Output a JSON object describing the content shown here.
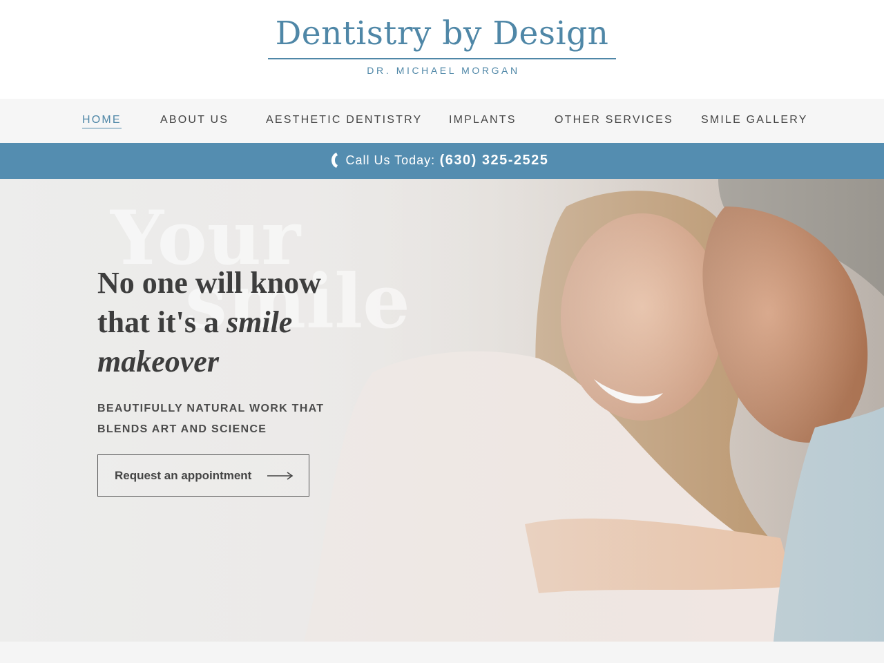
{
  "header": {
    "logo_title": "Dentistry by Design",
    "logo_subtitle": "DR. MICHAEL MORGAN"
  },
  "nav": {
    "items": [
      {
        "label": "HOME",
        "active": true
      },
      {
        "label": "ABOUT US",
        "active": false
      },
      {
        "label": "AESTHETIC DENTISTRY",
        "active": false
      },
      {
        "label": "IMPLANTS",
        "active": false
      },
      {
        "label": "OTHER SERVICES",
        "active": false
      },
      {
        "label": "SMILE GALLERY",
        "active": false
      }
    ]
  },
  "callbar": {
    "icon": "phone-icon",
    "label": "Call Us Today:",
    "number": "(630) 325-2525"
  },
  "hero": {
    "watermark_line1": "Your",
    "watermark_line2": "smile",
    "headline_plain_1": "No one will know",
    "headline_plain_2": "that it's a ",
    "headline_em_1": "smile",
    "headline_em_2": "makeover",
    "subline_1": "BEAUTIFULLY NATURAL WORK THAT",
    "subline_2": "BLENDS ART AND SCIENCE",
    "cta_label": "Request an appointment",
    "cta_icon": "arrow-right-icon"
  },
  "colors": {
    "brand": "#4f87a7",
    "callbar": "#548db0",
    "nav_bg": "#f6f6f6",
    "text_dark": "#3d3d3d"
  }
}
